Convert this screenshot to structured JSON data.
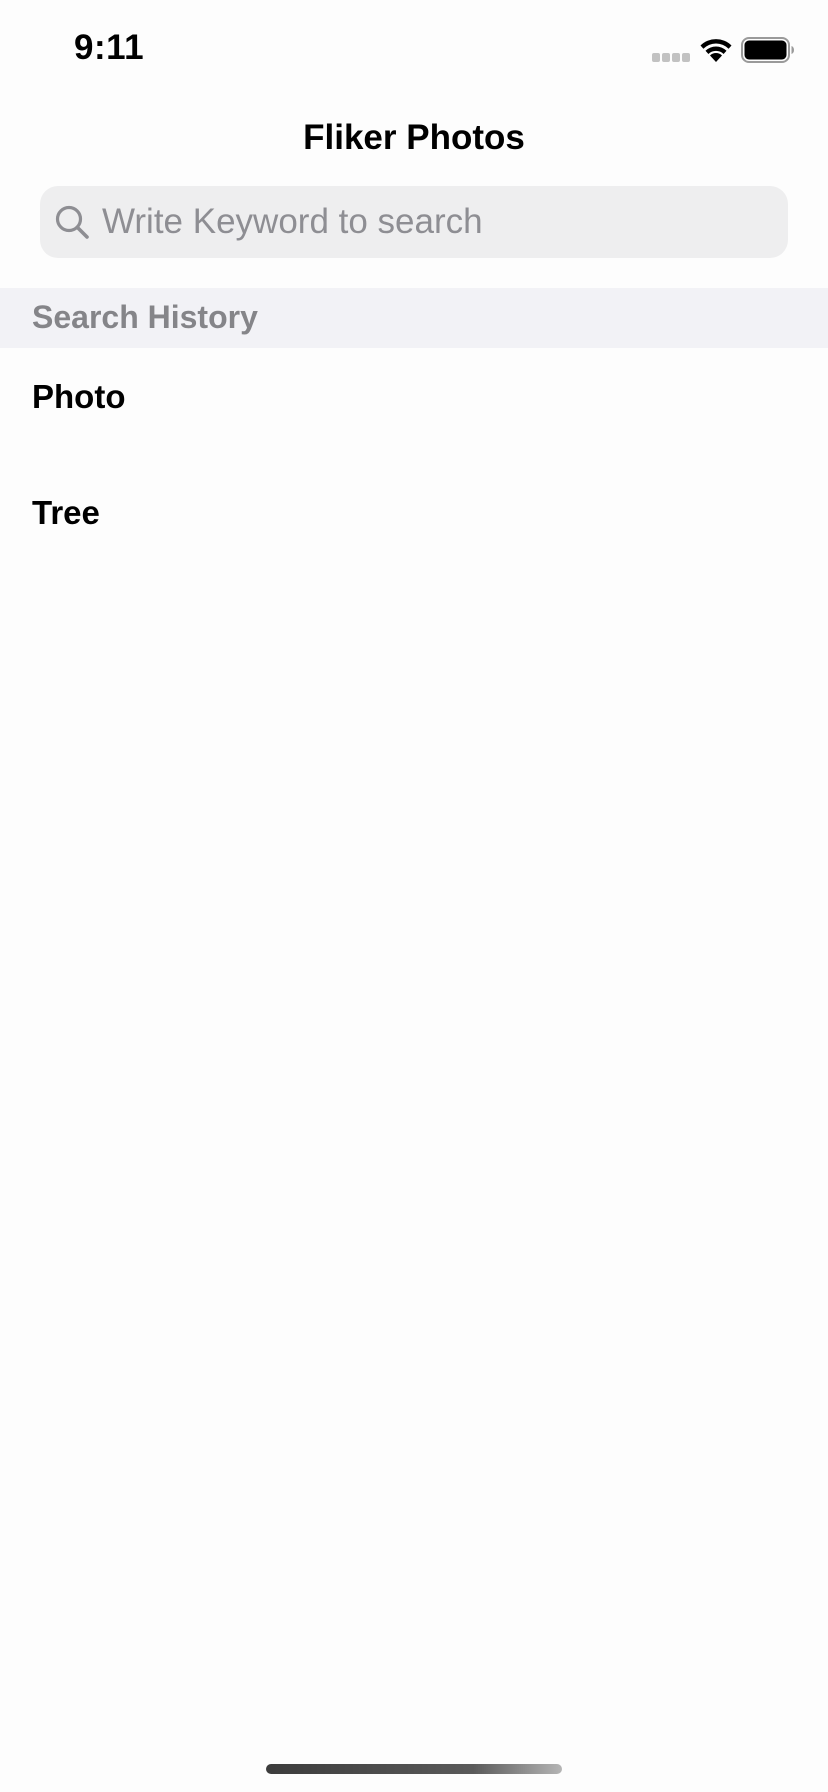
{
  "status_bar": {
    "time": "9:11"
  },
  "navigation": {
    "title": "Fliker Photos"
  },
  "search": {
    "placeholder": "Write Keyword to search",
    "value": "",
    "icon": "magnifying-glass"
  },
  "history": {
    "header": "Search History",
    "items": [
      {
        "label": "Photo"
      },
      {
        "label": "Tree"
      }
    ]
  },
  "colors": {
    "background": "#fdfdfd",
    "search_field": "#eeeeef",
    "placeholder": "#8e8e93",
    "section_header_bg": "#f2f2f6",
    "section_header_text": "#858589"
  }
}
